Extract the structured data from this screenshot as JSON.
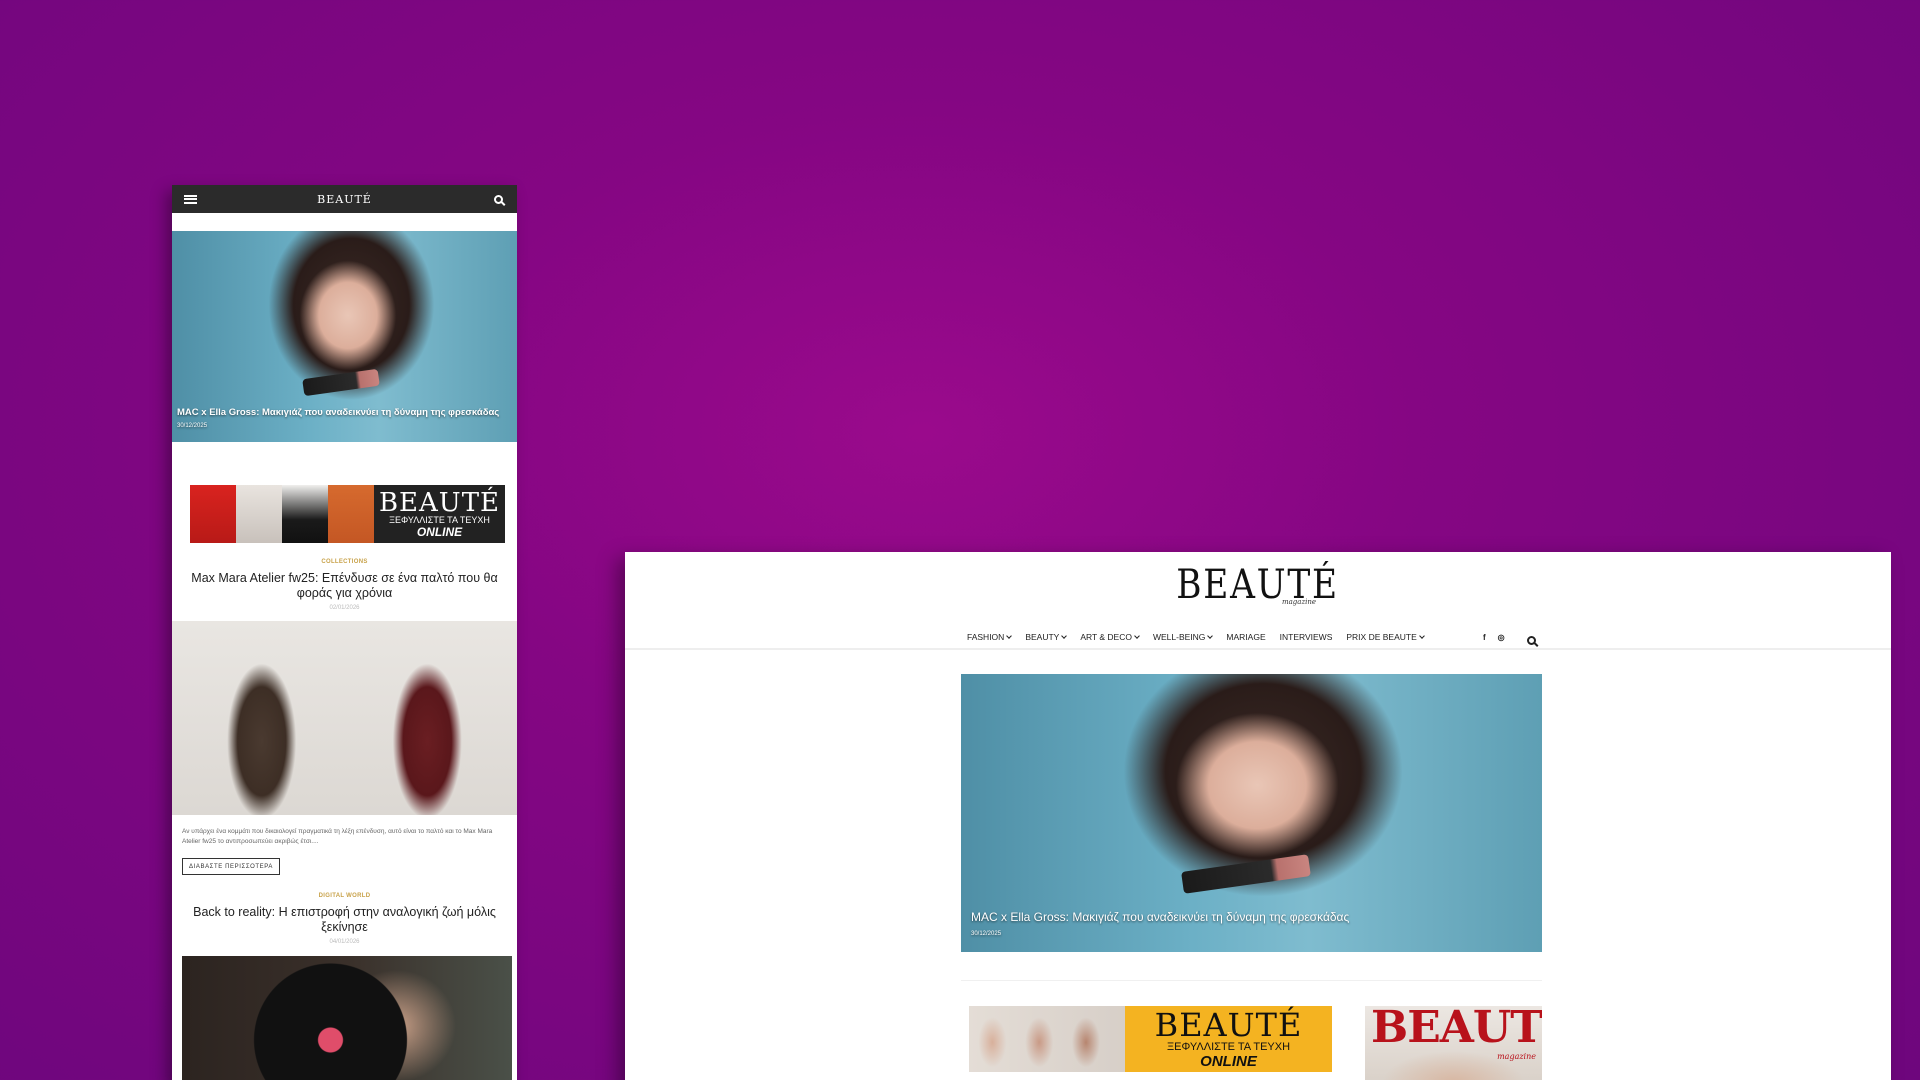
{
  "mobile": {
    "header_logo": "BEAUTÉ",
    "hero": {
      "title": "MAC x Ella Gross: Μακιγιάζ που αναδεικνύει τη δύναμη της φρεσκάδας",
      "date": "30/12/2025"
    },
    "banner": {
      "logo": "BEAUTÉ",
      "subtitle": "ΞΕΦΥΛΛΙΣΤΕ ΤΑ ΤΕΥΧΗ",
      "online": "ONLINE"
    },
    "article1": {
      "category": "COLLECTIONS",
      "title": "Max Mara Atelier fw25: Επένδυσε σε ένα παλτό που θα φοράς για χρόνια",
      "date": "02/01/2026",
      "excerpt": "Αν υπάρχει ένα κομμάτι που δικαιολογεί πραγματικά τη λέξη επένδυση, αυτό είναι το παλτό και το Max Mara Atelier fw25 το αντιπροσωπεύει ακριβώς έτσι....",
      "read_more": "ΔΙΑΒΑΣΤΕ ΠΕΡΙΣΣΟΤΕΡΑ"
    },
    "article2": {
      "category": "DIGITAL WORLD",
      "title": "Back to reality: Η επιστροφή στην αναλογική ζωή μόλις ξεκίνησε",
      "date": "04/01/2026"
    }
  },
  "desktop": {
    "logo": "BEAUTÉ",
    "tagline": "magazine",
    "nav": [
      {
        "label": "FASHION",
        "dropdown": true
      },
      {
        "label": "BEAUTY",
        "dropdown": true
      },
      {
        "label": "ART & DECO",
        "dropdown": true
      },
      {
        "label": "WELL-BEING",
        "dropdown": true
      },
      {
        "label": "MARIAGE",
        "dropdown": false
      },
      {
        "label": "INTERVIEWS",
        "dropdown": false
      },
      {
        "label": "PRIX DE BEAUTE",
        "dropdown": true
      }
    ],
    "social": {
      "facebook": "f",
      "instagram": "◎"
    },
    "hero": {
      "title": "MAC x Ella Gross: Μακιγιάζ που αναδεικνύει τη δύναμη της φρεσκάδας",
      "date": "30/12/2025"
    },
    "banner": {
      "logo": "BEAUTÉ",
      "subtitle": "ΞΕΦΥΛΛΙΣΤΕ ΤΑ ΤΕΥΧΗ",
      "online": "ONLINE"
    },
    "cover": {
      "title": "BEAUTÉ",
      "tag": "magazine"
    }
  },
  "colors": {
    "background": "#850683",
    "accent_gold": "#c8a24a",
    "banner_yellow": "#f4b321",
    "cover_red": "#b8121b"
  }
}
